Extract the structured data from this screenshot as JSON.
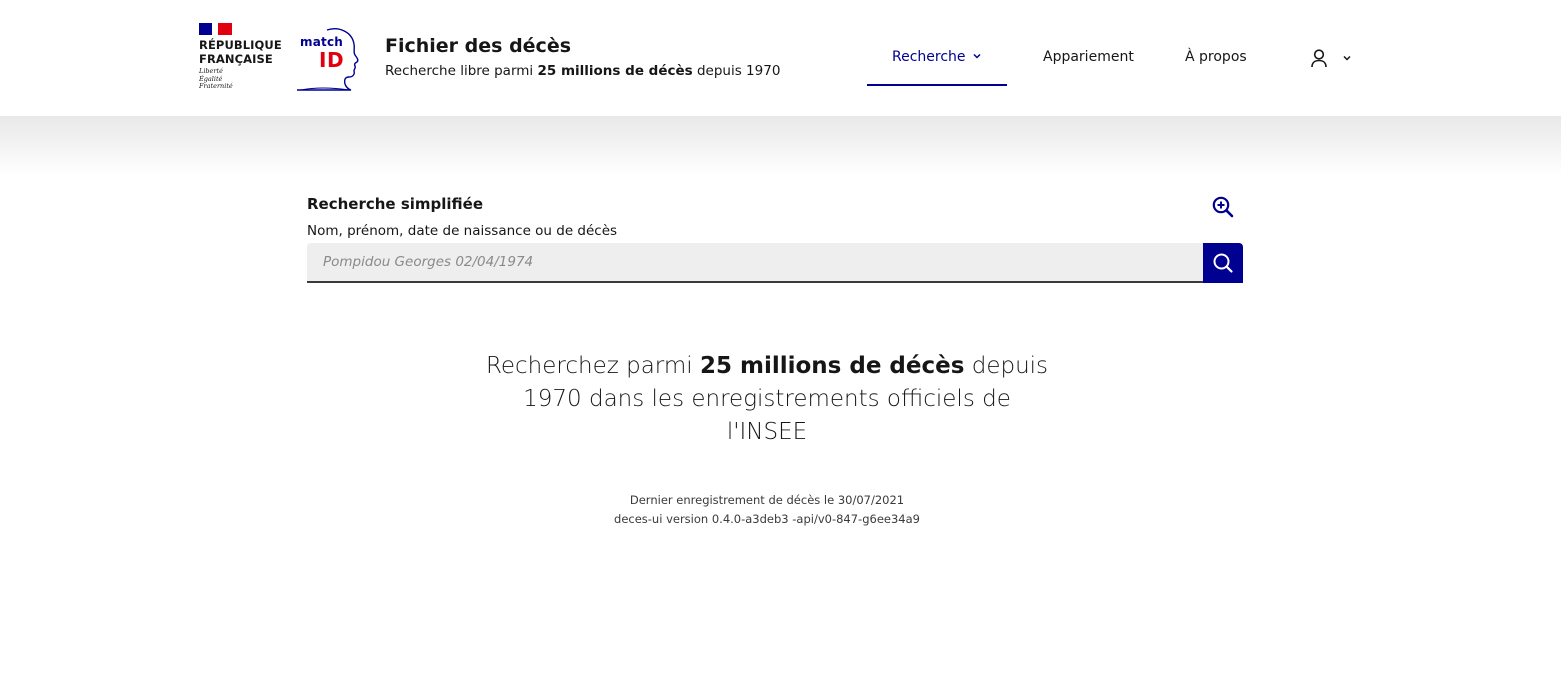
{
  "header": {
    "republique": [
      "RÉPUBLIQUE",
      "FRANÇAISE"
    ],
    "devise": [
      "Liberté",
      "Égalité",
      "Fraternité"
    ],
    "logo": {
      "match": "match",
      "id": "ID"
    },
    "service": {
      "title": "Fichier des décès",
      "tagline_pre": "Recherche libre parmi ",
      "tagline_bold": "25 millions de décès",
      "tagline_post": " depuis 1970"
    },
    "nav": {
      "recherche": "Recherche",
      "appariement": "Appariement",
      "apropos": "À propos"
    },
    "icons": {
      "chevron": "chevron-down-icon",
      "user": "user-icon",
      "zoom": "zoom-in-icon",
      "search": "search-icon"
    }
  },
  "search": {
    "heading": "Recherche simplifiée",
    "label": "Nom, prénom, date de naissance ou de décès",
    "placeholder": "Pompidou Georges 02/04/1974",
    "value": ""
  },
  "hero": {
    "pre": "Recherchez parmi ",
    "bold": "25 millions de décès",
    "post": " depuis 1970 dans les enregistrements officiels de l'INSEE"
  },
  "footer_meta": {
    "last_record": "Dernier enregistrement de décès le 30/07/2021",
    "version": "deces-ui version 0.4.0-a3deb3 -api/v0-847-g6ee34a9"
  },
  "colors": {
    "primary": "#000091",
    "accent_red": "#e1000f",
    "input_bg": "#eeeeee",
    "text": "#161616"
  }
}
